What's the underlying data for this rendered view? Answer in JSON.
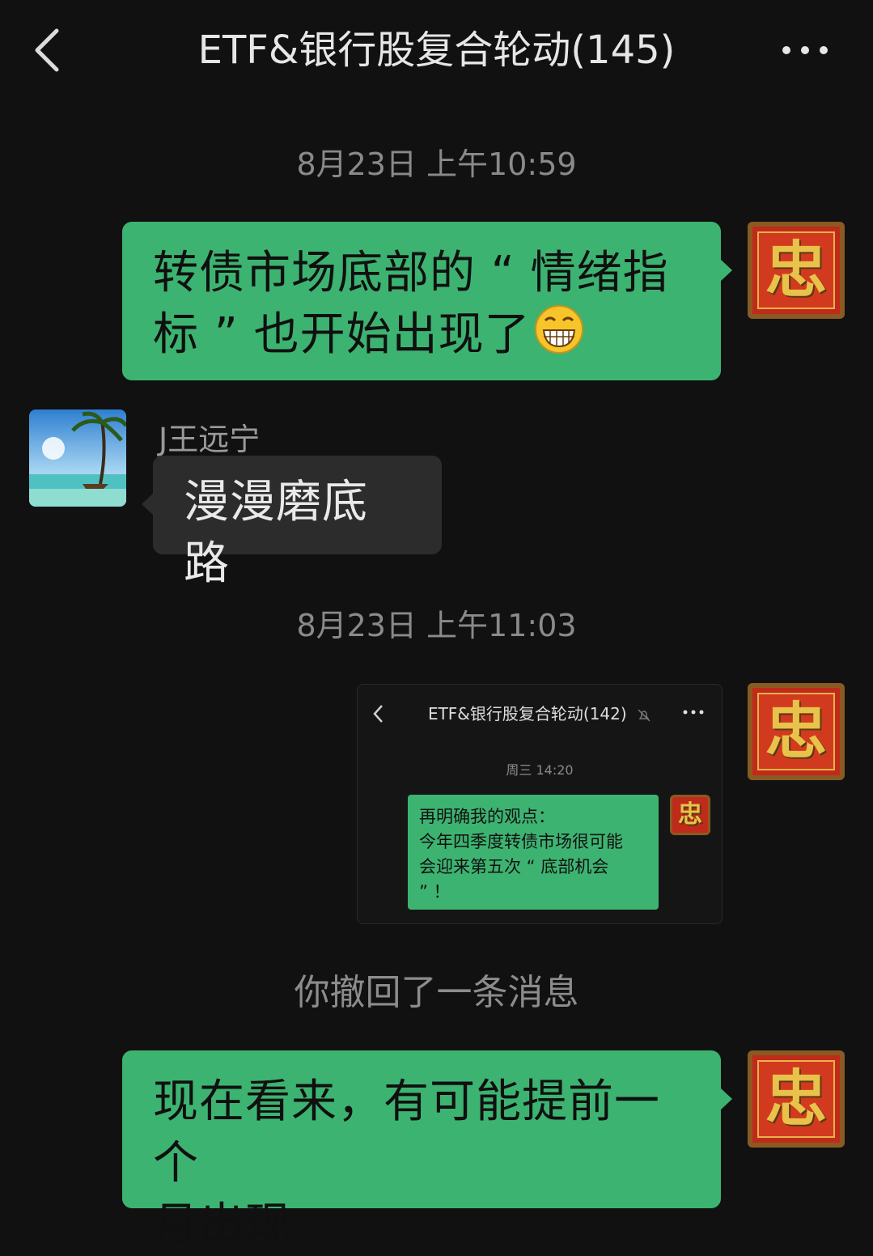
{
  "header": {
    "title": "ETF&银行股复合轮动(145)",
    "back_icon": "chevron-left-icon",
    "more_icon": "more-dots-icon"
  },
  "messages": [
    {
      "type": "timestamp",
      "text": "8月23日 上午10:59"
    },
    {
      "type": "outgoing",
      "lines": [
        "转债市场底部的 “ 情绪指",
        "标 ” 也开始出现了"
      ],
      "emoji": "grinning-face-icon",
      "avatar_glyph": "忠"
    },
    {
      "type": "incoming",
      "sender": "J王远宁",
      "text": "漫漫磨底路"
    },
    {
      "type": "timestamp",
      "text": "8月23日 上午11:03"
    },
    {
      "type": "outgoing-image",
      "avatar_glyph": "忠",
      "image": {
        "title": "ETF&银行股复合轮动(142)",
        "time": "周三 14:20",
        "avatar_glyph": "忠",
        "bubble_lines": [
          "再明确我的观点：",
          "今年四季度转债市场很可能",
          "会迎来第五次 “ 底部机会",
          "” ！"
        ]
      }
    },
    {
      "type": "system",
      "text": "你撤回了一条消息"
    },
    {
      "type": "outgoing",
      "lines": [
        "现在看来，有可能提前一个",
        "月出现"
      ],
      "avatar_glyph": "忠"
    }
  ],
  "colors": {
    "background": "#111111",
    "outgoing_bubble": "#3db371",
    "incoming_bubble": "#2c2c2c",
    "timestamp": "#8a8a8a"
  }
}
